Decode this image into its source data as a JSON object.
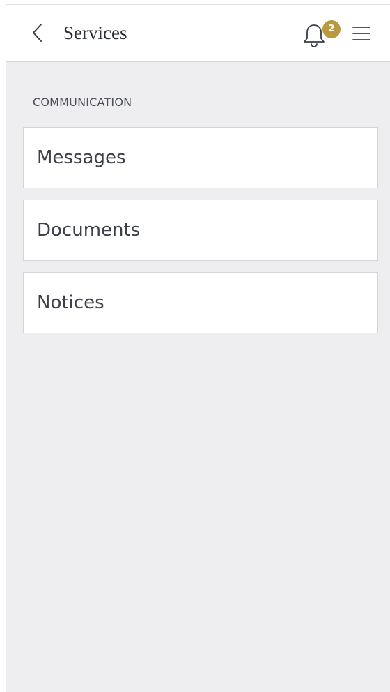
{
  "header": {
    "title": "Services",
    "back_icon": "chevron-left-icon",
    "notification_icon": "bell-icon",
    "notification_count": "2",
    "menu_icon": "hamburger-menu-icon"
  },
  "section": {
    "title": "COMMUNICATION",
    "items": [
      {
        "label": "Messages"
      },
      {
        "label": "Documents"
      },
      {
        "label": "Notices"
      }
    ]
  },
  "colors": {
    "accent": "#b8993d",
    "background": "#eeeef0",
    "surface": "#ffffff",
    "text": "#3c4048"
  }
}
